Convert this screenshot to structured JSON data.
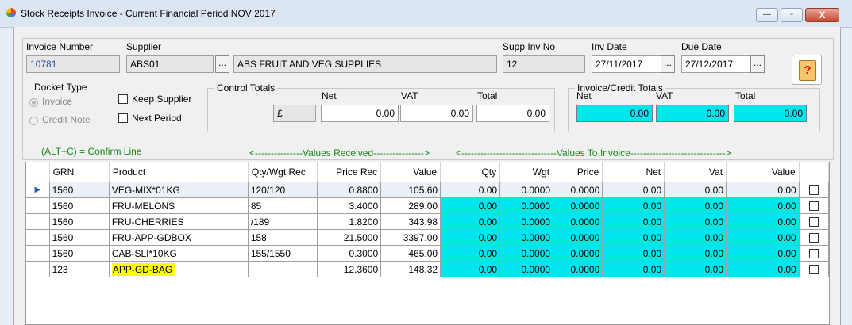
{
  "window": {
    "title": "Stock Receipts Invoice - Current Financial Period NOV 2017",
    "minimize_glyph": "—",
    "maximize_glyph": "▫",
    "close_glyph": "X"
  },
  "header": {
    "invoice_number_label": "Invoice Number",
    "invoice_number": "10781",
    "supplier_label": "Supplier",
    "supplier_code": "ABS01",
    "supplier_name": "ABS  FRUIT AND VEG SUPPLIES",
    "supp_inv_no_label": "Supp Inv No",
    "supp_inv_no": "12",
    "inv_date_label": "Inv Date",
    "inv_date": "27/11/2017",
    "due_date_label": "Due Date",
    "due_date": "27/12/2017",
    "lookup_glyph": "..."
  },
  "docket_type": {
    "label": "Docket Type",
    "options": [
      "Invoice",
      "Credit Note"
    ],
    "selected": "Invoice"
  },
  "options": {
    "keep_supplier": "Keep Supplier",
    "next_period": "Next Period"
  },
  "control_totals": {
    "label": "Control Totals",
    "currency": "£",
    "net_label": "Net",
    "vat_label": "VAT",
    "total_label": "Total",
    "net": "0.00",
    "vat": "0.00",
    "total": "0.00"
  },
  "invoice_totals": {
    "label": "Invoice/Credit Totals",
    "net_label": "Net",
    "vat_label": "VAT",
    "total_label": "Total",
    "net": "0.00",
    "vat": "0.00",
    "total": "0.00"
  },
  "hints": {
    "confirm_line": "(ALT+C) = Confirm Line",
    "values_received": "<---------------Values Received---------------->",
    "values_to_invoice": "<------------------------------Values To Invoice------------------------------>"
  },
  "grid": {
    "columns": [
      "GRN",
      "Product",
      "Qty/Wgt Rec",
      "Price Rec",
      "Value",
      "Qty",
      "Wgt",
      "Price",
      "Net",
      "Vat",
      "Value"
    ],
    "rows": [
      {
        "grn": "1560",
        "product": "VEG-MIX*01KG",
        "qty_rec": "120/120",
        "price_rec": "0.8800",
        "value_rec": "105.60",
        "qty": "0.00",
        "wgt": "0.0000",
        "price": "0.0000",
        "net": "0.00",
        "vat": "0.00",
        "value": "0.00"
      },
      {
        "grn": "1560",
        "product": "FRU-MELONS",
        "qty_rec": "85",
        "price_rec": "3.4000",
        "value_rec": "289.00",
        "qty": "0.00",
        "wgt": "0.0000",
        "price": "0.0000",
        "net": "0.00",
        "vat": "0.00",
        "value": "0.00"
      },
      {
        "grn": "1560",
        "product": "FRU-CHERRIES",
        "qty_rec": "/189",
        "price_rec": "1.8200",
        "value_rec": "343.98",
        "qty": "0.00",
        "wgt": "0.0000",
        "price": "0.0000",
        "net": "0.00",
        "vat": "0.00",
        "value": "0.00"
      },
      {
        "grn": "1560",
        "product": "FRU-APP-GDBOX",
        "qty_rec": "158",
        "price_rec": "21.5000",
        "value_rec": "3397.00",
        "qty": "0.00",
        "wgt": "0.0000",
        "price": "0.0000",
        "net": "0.00",
        "vat": "0.00",
        "value": "0.00"
      },
      {
        "grn": "1560",
        "product": "CAB-SLI*10KG",
        "qty_rec": "155/1550",
        "price_rec": "0.3000",
        "value_rec": "465.00",
        "qty": "0.00",
        "wgt": "0.0000",
        "price": "0.0000",
        "net": "0.00",
        "vat": "0.00",
        "value": "0.00"
      },
      {
        "grn": "123",
        "product": "APP-GD-BAG",
        "qty_rec": "",
        "price_rec": "12.3600",
        "value_rec": "148.32",
        "qty": "0.00",
        "wgt": "0.0000",
        "price": "0.0000",
        "net": "0.00",
        "vat": "0.00",
        "value": "0.00"
      }
    ]
  },
  "colors": {
    "cyan": "#00e6ec",
    "highlight": "#ffff00",
    "hint_green": "#1a8a1a"
  }
}
